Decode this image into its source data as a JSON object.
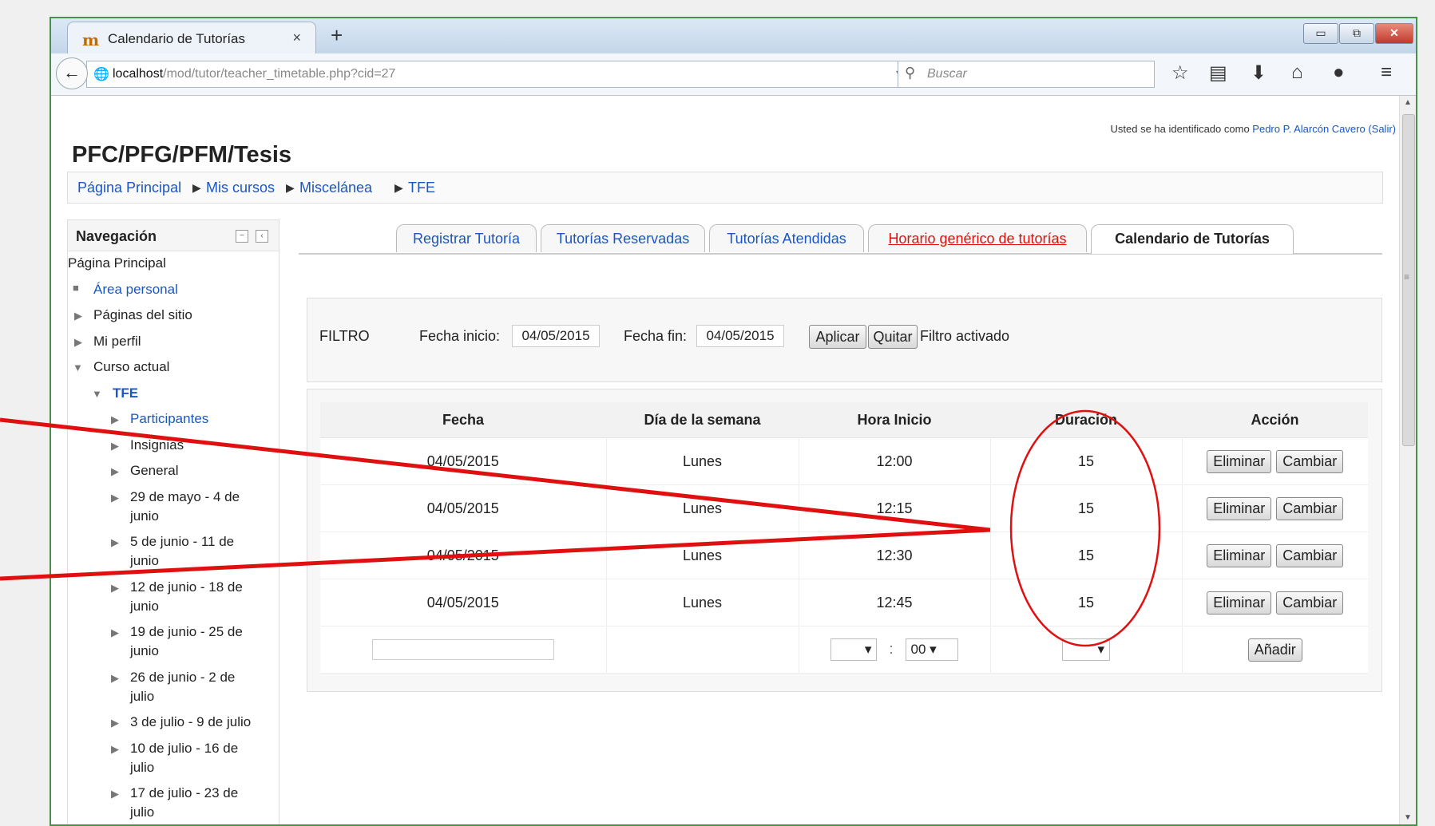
{
  "browser": {
    "tab_title": "Calendario de Tutorías",
    "tab_close": "×",
    "new_tab": "+",
    "url_host": "localhost",
    "url_path": "/mod/tutor/teacher_timetable.php?cid=27",
    "reload": "▿ C",
    "search_placeholder": "Buscar",
    "win_min": "▭",
    "win_restore": "⧉",
    "win_close": "✕",
    "back": "←",
    "globe": "🌐",
    "mag": "⚲",
    "icons": {
      "bookmark": "☆",
      "reader": "▤",
      "download": "⬇",
      "home": "⌂",
      "chat": "●",
      "menu": "≡"
    }
  },
  "header": {
    "login_prefix": "Usted se ha identificado como ",
    "login_user": "Pedro P. Alarcón Cavero",
    "login_logout": "(Salir)",
    "site_title": "PFC/PFG/PFM/Tesis"
  },
  "breadcrumb": [
    "Página Principal",
    "Mis cursos",
    "Miscelánea",
    "TFE"
  ],
  "breadcrumb_sep": "▶",
  "navigation": {
    "title": "Navegación",
    "items": [
      "Página Principal",
      "Área personal",
      "Páginas del sitio",
      "Mi perfil",
      "Curso actual",
      "TFE",
      "Participantes",
      "Insignias",
      "General",
      "29 de mayo - 4 de",
      "junio",
      "5 de junio - 11 de",
      "junio",
      "12 de junio - 18 de",
      "junio",
      "19 de junio - 25 de",
      "junio",
      "26 de junio - 2 de",
      "julio",
      "3 de julio - 9 de julio",
      "10 de julio - 16 de",
      "julio",
      "17 de julio - 23 de",
      "julio"
    ]
  },
  "tabs": [
    "Registrar Tutoría",
    "Tutorías Reservadas",
    "Tutorías Atendidas",
    "Horario genérico de tutorías",
    "Calendario de Tutorías"
  ],
  "filter": {
    "label": "FILTRO",
    "start_label": "Fecha inicio:",
    "start_value": "04/05/2015",
    "end_label": "Fecha fin:",
    "end_value": "04/05/2015",
    "apply": "Aplicar",
    "remove": "Quitar",
    "status": "Filtro activado"
  },
  "table": {
    "headers": [
      "Fecha",
      "Día de la semana",
      "Hora Inicio",
      "Duración",
      "Acción"
    ],
    "rows": [
      {
        "fecha": "04/05/2015",
        "dia": "Lunes",
        "hora": "12:00",
        "duracion": "15"
      },
      {
        "fecha": "04/05/2015",
        "dia": "Lunes",
        "hora": "12:15",
        "duracion": "15"
      },
      {
        "fecha": "04/05/2015",
        "dia": "Lunes",
        "hora": "12:30",
        "duracion": "15"
      },
      {
        "fecha": "04/05/2015",
        "dia": "Lunes",
        "hora": "12:45",
        "duracion": "15"
      }
    ],
    "delete": "Eliminar",
    "change": "Cambiar",
    "minutes_default": "00",
    "time_sep": ":",
    "add": "Añadir"
  },
  "colors": {
    "annotation": "#e01010",
    "link": "#1a56c4",
    "active_tab_link": "#e01010"
  }
}
